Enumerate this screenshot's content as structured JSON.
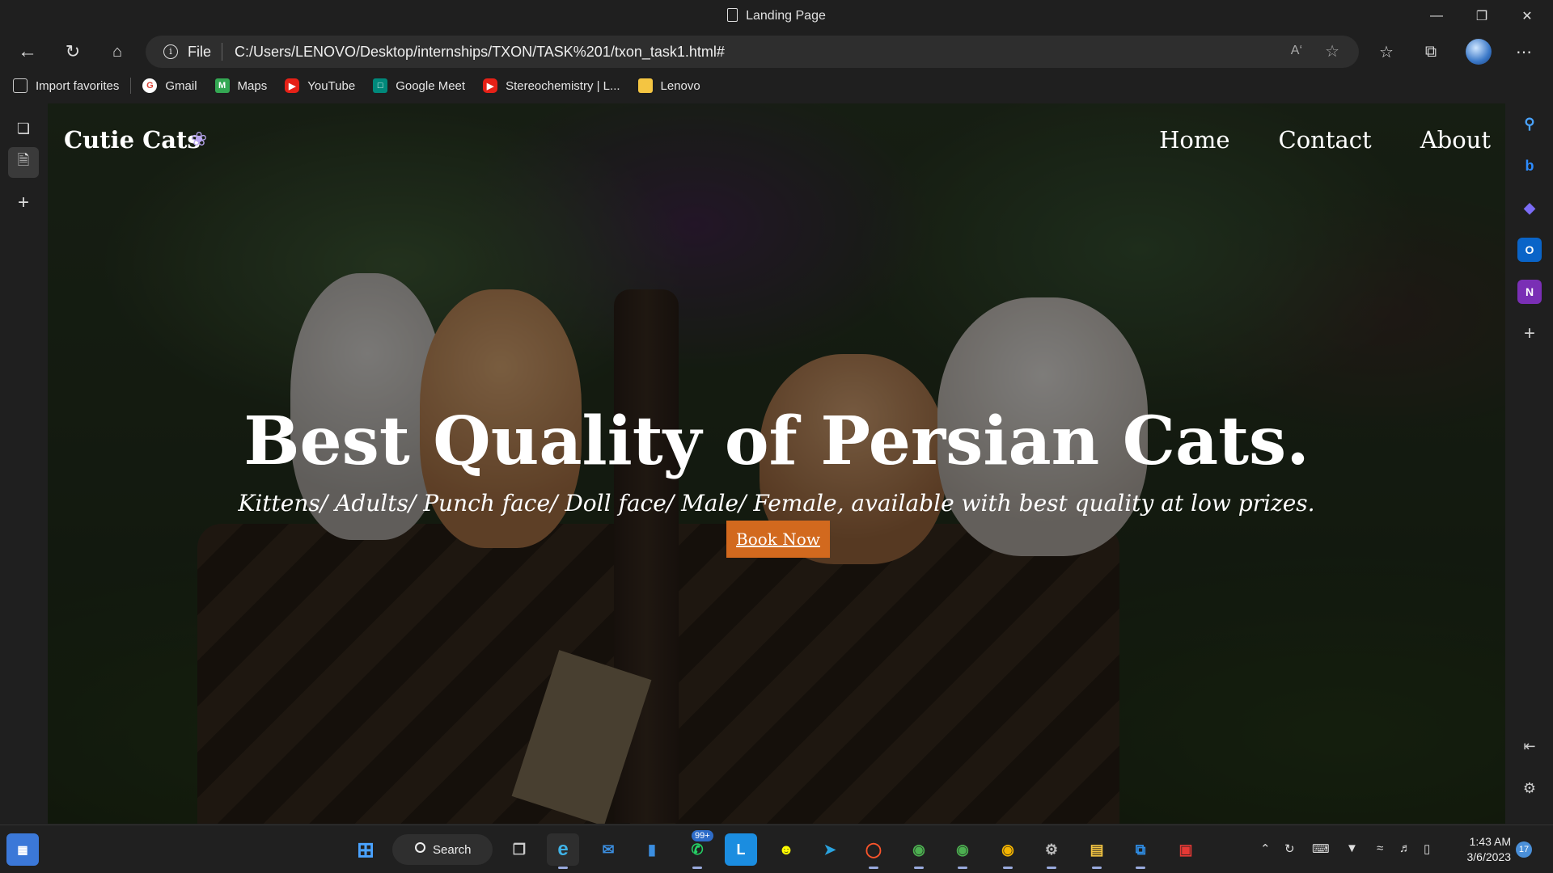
{
  "window": {
    "title": "Landing Page"
  },
  "address_bar": {
    "scheme_label": "File",
    "url": "C:/Users/LENOVO/Desktop/internships/TXON/TASK%201/txon_task1.html#"
  },
  "favorites": [
    {
      "label": "Import favorites",
      "icon": "import-icon"
    },
    {
      "label": "Gmail",
      "icon": "google-icon"
    },
    {
      "label": "Maps",
      "icon": "maps-icon"
    },
    {
      "label": "YouTube",
      "icon": "youtube-icon"
    },
    {
      "label": "Google Meet",
      "icon": "meet-icon"
    },
    {
      "label": "Stereochemistry | L...",
      "icon": "youtube-icon"
    },
    {
      "label": "Lenovo",
      "icon": "folder-icon"
    }
  ],
  "page": {
    "brand": "Cutie Cats",
    "nav": [
      "Home",
      "Contact",
      "About"
    ],
    "hero_title": "Best Quality of Persian Cats.",
    "hero_subtitle": "Kittens/ Adults/ Punch face/ Doll face/ Male/ Female, available with best quality at low prizes.",
    "cta_label": "Book Now",
    "cta_color": "#d2691e"
  },
  "taskbar": {
    "search_label": "Search",
    "whatsapp_badge": "99+",
    "time": "1:43 AM",
    "date": "3/6/2023",
    "notification_count": "17"
  }
}
